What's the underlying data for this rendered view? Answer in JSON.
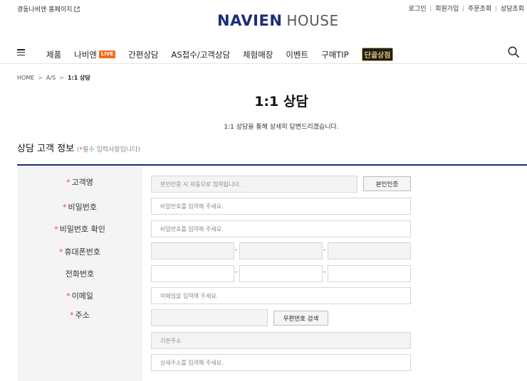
{
  "topbar": {
    "ext_link": "경동나비엔 홈페이지",
    "util": [
      "로그인",
      "회원가입",
      "주문조회",
      "상담조회"
    ]
  },
  "logo": {
    "brand": "NAVIEN",
    "house": "HOUSE"
  },
  "nav": {
    "items": [
      "제품",
      "나비엔",
      "간편상담",
      "AS접수/고객상담",
      "체험매장",
      "이벤트",
      "구매TIP"
    ],
    "live_badge": "LIVE",
    "special": "단골상점"
  },
  "breadcrumb": [
    "HOME",
    "A/S",
    "1:1 상담"
  ],
  "page": {
    "title": "1:1 상담",
    "desc": "1:1 상담을 통해 상세히 답변드리겠습니다."
  },
  "section": {
    "title": "상담 고객 정보",
    "req_star": "*",
    "req_text": "필수 입력사항입니다"
  },
  "form": {
    "required_mark": "*",
    "name_label": "고객명",
    "name_placeholder": "본인인증 시 자동으로 입력됩니다.",
    "verify_button": "본인인증",
    "pw_label": "비밀번호",
    "pw_placeholder": "비밀번호를 입력해 주세요.",
    "pw_confirm_label": "비밀번호 확인",
    "pw_confirm_placeholder": "비밀번호를 입력해 주세요.",
    "mobile_label": "휴대폰번호",
    "phone_label": "전화번호",
    "dash": "-",
    "email_label": "이메일",
    "email_placeholder": "이메일을 입력해 주세요.",
    "address_label": "주소",
    "zip_button": "우편번호 검색",
    "address_base_placeholder": "기본주소",
    "address_detail_placeholder": "상세주소를 입력해 주세요."
  }
}
